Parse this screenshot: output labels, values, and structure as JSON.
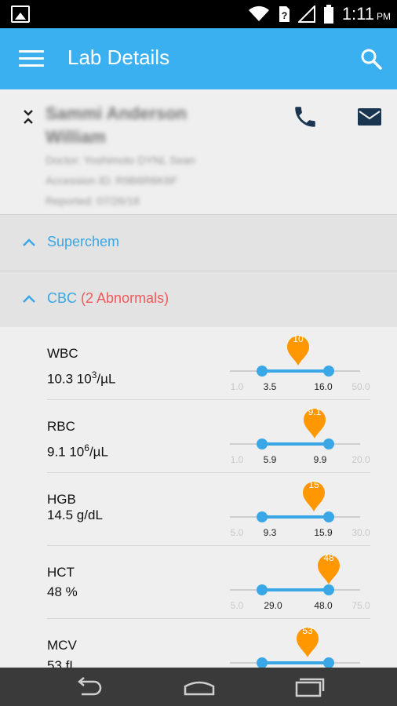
{
  "status_bar": {
    "time": "1:11",
    "ampm": "PM",
    "icons": [
      "image-icon",
      "wifi-icon",
      "sim-icon",
      "signal-icon",
      "battery-icon"
    ]
  },
  "app_bar": {
    "title": "Lab Details",
    "icons": [
      "menu-icon",
      "search-icon"
    ]
  },
  "patient": {
    "name": "Sammi Anderson William",
    "doctor": "Doctor: Yoshimoto DYNL Sean",
    "accession": "Accession ID: R9B6R6K6F",
    "reported": "Reported: 07/26/18"
  },
  "sections": [
    {
      "label": "Superchem",
      "abnormals": ""
    },
    {
      "label": "CBC",
      "abnormals": "(2 Abnormals)"
    }
  ],
  "labs": [
    {
      "name": "WBC",
      "value": "10.3 10",
      "exp": "3",
      "unit": "/µL",
      "min": "1.0",
      "low": "3.5",
      "high": "16.0",
      "max": "50.0",
      "result": "10"
    },
    {
      "name": "RBC",
      "value": "9.1 10",
      "exp": "6",
      "unit": "/µL",
      "min": "1.0",
      "low": "5.9",
      "high": "9.9",
      "max": "20.0",
      "result": "9.1"
    },
    {
      "name": "HGB",
      "value": "14.5 g/dL",
      "exp": "",
      "unit": "",
      "min": "5.0",
      "low": "9.3",
      "high": "15.9",
      "max": "30.0",
      "result": "15"
    },
    {
      "name": "HCT",
      "value": "48 %",
      "exp": "",
      "unit": "",
      "min": "5.0",
      "low": "29.0",
      "high": "48.0",
      "max": "75.0",
      "result": "48"
    },
    {
      "name": "MCV",
      "value": "53 fL",
      "exp": "",
      "unit": "",
      "min": "",
      "low": "",
      "high": "",
      "max": "",
      "result": "53"
    }
  ],
  "colors": {
    "app_bar": "#3bb0f0",
    "accent": "#38a6e6",
    "abnormal": "#f05a5a",
    "pin": "#ff9800",
    "nav_bar": "#3a3a3a"
  },
  "nav_bar": [
    "back-icon",
    "home-icon",
    "recents-icon"
  ]
}
